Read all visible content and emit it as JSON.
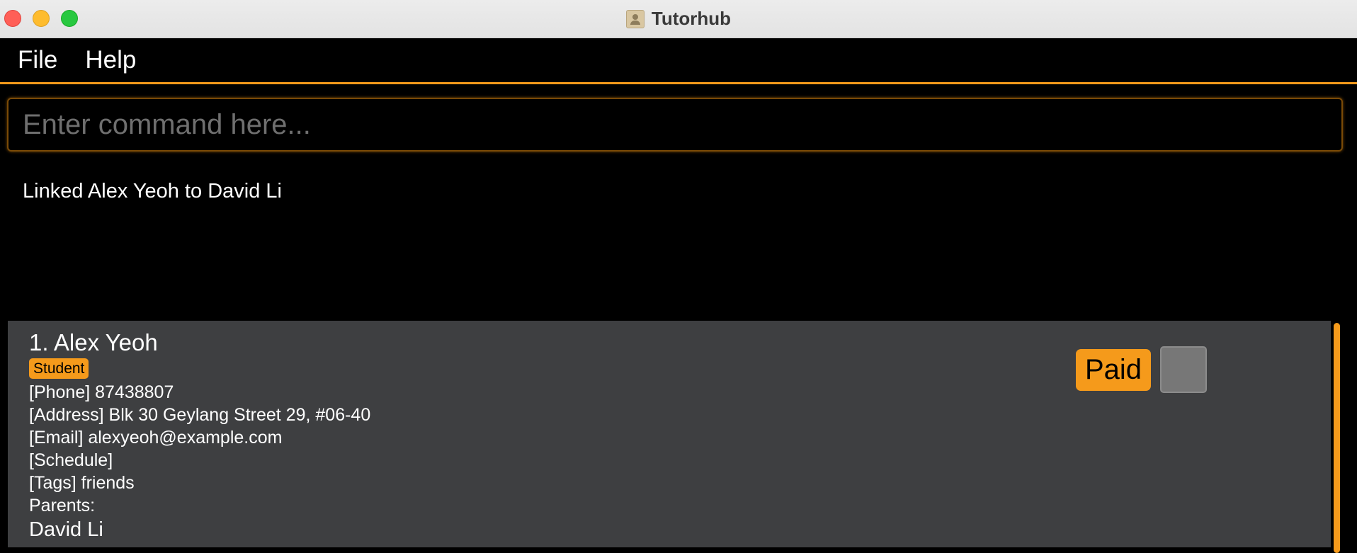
{
  "window": {
    "title": "Tutorhub",
    "app_icon": "contact-book-icon"
  },
  "menu": {
    "items": [
      {
        "label": "File"
      },
      {
        "label": "Help"
      }
    ]
  },
  "command": {
    "placeholder": "Enter command here...",
    "value": ""
  },
  "result": {
    "message": "Linked Alex Yeoh to David Li"
  },
  "persons": [
    {
      "index_name": "1. Alex Yeoh",
      "role": "Student",
      "phone": "[Phone] 87438807",
      "address": "[Address] Blk 30 Geylang Street 29, #06-40",
      "email": "[Email] alexyeoh@example.com",
      "schedule": "[Schedule]",
      "tags": "[Tags] friends",
      "parents_label": "Parents:",
      "parents": [
        "David Li"
      ],
      "paid_label": "Paid",
      "paid_checked": false
    }
  ],
  "colors": {
    "accent": "#f59a1b",
    "background": "#000000",
    "card": "#3e3f41"
  }
}
